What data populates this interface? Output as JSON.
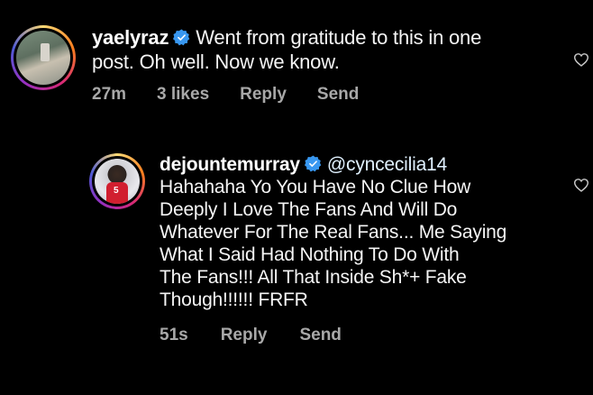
{
  "comments": [
    {
      "username": "yaelyraz",
      "verified": true,
      "text_lines": [
        "Went from gratitude to this in one",
        "post. Oh well. Now we know."
      ],
      "time": "27m",
      "likes": "3 likes",
      "reply_label": "Reply",
      "send_label": "Send"
    }
  ],
  "reply": {
    "username": "dejountemurray",
    "verified": true,
    "mention": "@cyncecilia14",
    "text_lines": [
      "Hahahaha Yo You Have No Clue How",
      "Deeply I Love The Fans And Will Do",
      "Whatever For The Real Fans... Me Saying",
      "What I Said Had Nothing To Do With",
      "The Fans!!! All That Inside Sh*+ Fake",
      "Though!!!!!! FRFR"
    ],
    "time": "51s",
    "reply_label": "Reply",
    "send_label": "Send",
    "avatar_jersey_number": "5"
  },
  "icons": {
    "verified": "verified-badge-icon",
    "like": "heart-outline-icon"
  },
  "colors": {
    "background": "#000000",
    "text": "#f5f5f5",
    "meta": "#a8a8a8",
    "verified": "#3897f0"
  }
}
